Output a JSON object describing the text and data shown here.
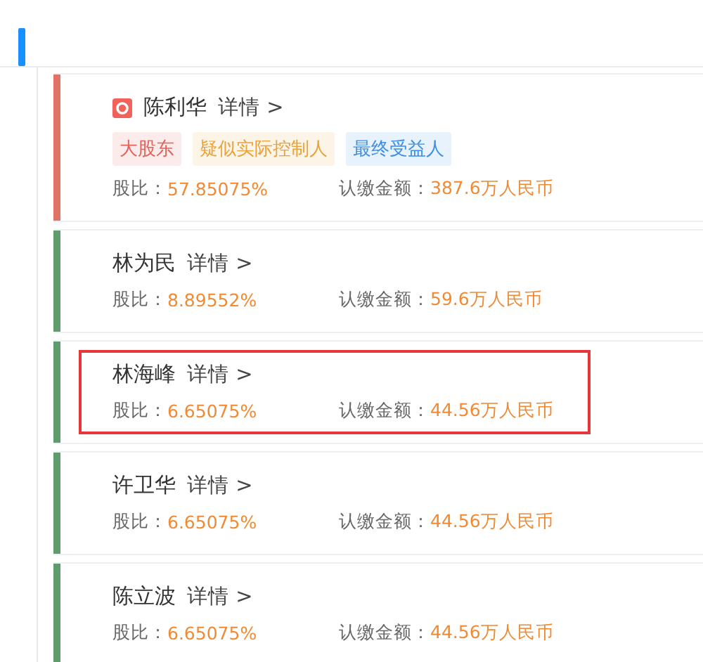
{
  "shareholders": [
    {
      "name": "陈利华",
      "detail": "详情 >",
      "has_icon": true,
      "color": "#e07366",
      "highlighted": false,
      "tags": [
        {
          "label": "大股东",
          "color": "#e0645c"
        },
        {
          "label": "疑似实际控制人",
          "color": "#e9a23b"
        },
        {
          "label": "最终受益人",
          "color": "#3d8fe6"
        }
      ],
      "ratio_label": "股比：",
      "ratio": "57.85075%",
      "amount_label": "认缴金额：",
      "amount": "387.6万人民币"
    },
    {
      "name": "林为民",
      "detail": "详情 >",
      "has_icon": false,
      "color": "#5e9c6e",
      "highlighted": false,
      "ratio_label": "股比：",
      "ratio": "8.89552%",
      "amount_label": "认缴金额：",
      "amount": "59.6万人民币"
    },
    {
      "name": "林海峰",
      "detail": "详情 >",
      "has_icon": false,
      "color": "#5e9c6e",
      "highlighted": true,
      "ratio_label": "股比：",
      "ratio": "6.65075%",
      "amount_label": "认缴金额：",
      "amount": "44.56万人民币"
    },
    {
      "name": "许卫华",
      "detail": "详情 >",
      "has_icon": false,
      "color": "#5e9c6e",
      "highlighted": false,
      "ratio_label": "股比：",
      "ratio": "6.65075%",
      "amount_label": "认缴金额：",
      "amount": "44.56万人民币"
    },
    {
      "name": "陈立波",
      "detail": "详情 >",
      "has_icon": false,
      "color": "#5e9c6e",
      "highlighted": false,
      "ratio_label": "股比：",
      "ratio": "6.65075%",
      "amount_label": "认缴金额：",
      "amount": "44.56万人民币"
    }
  ]
}
